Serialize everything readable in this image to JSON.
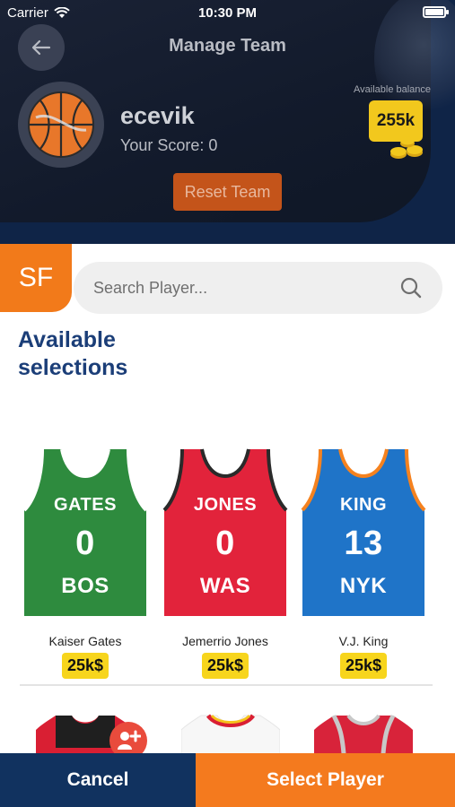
{
  "status_bar": {
    "carrier": "Carrier",
    "time": "10:30 PM"
  },
  "header": {
    "title": "Manage Team",
    "username": "ecevik",
    "score": "Your Score: 0",
    "balance_label": "Available balance",
    "balance_value": "255k",
    "reset_label": "Reset Team"
  },
  "position": {
    "label": "SF"
  },
  "search": {
    "placeholder": "Search Player..."
  },
  "section_title": "Available selections",
  "players": [
    {
      "name": "Kaiser Gates",
      "price": "25k$",
      "jersey_name": "GATES",
      "number": "0",
      "team": "BOS",
      "color": "#2e8b3e",
      "trim": "#ffffff"
    },
    {
      "name": "Jemerrio Jones",
      "price": "25k$",
      "jersey_name": "JONES",
      "number": "0",
      "team": "WAS",
      "color": "#e2233b",
      "trim": "#2a2a2a"
    },
    {
      "name": "V.J. King",
      "price": "25k$",
      "jersey_name": "KING",
      "number": "13",
      "team": "NYK",
      "color": "#1f74c8",
      "trim": "#f5821f"
    }
  ],
  "footer": {
    "cancel": "Cancel",
    "select": "Select Player"
  }
}
